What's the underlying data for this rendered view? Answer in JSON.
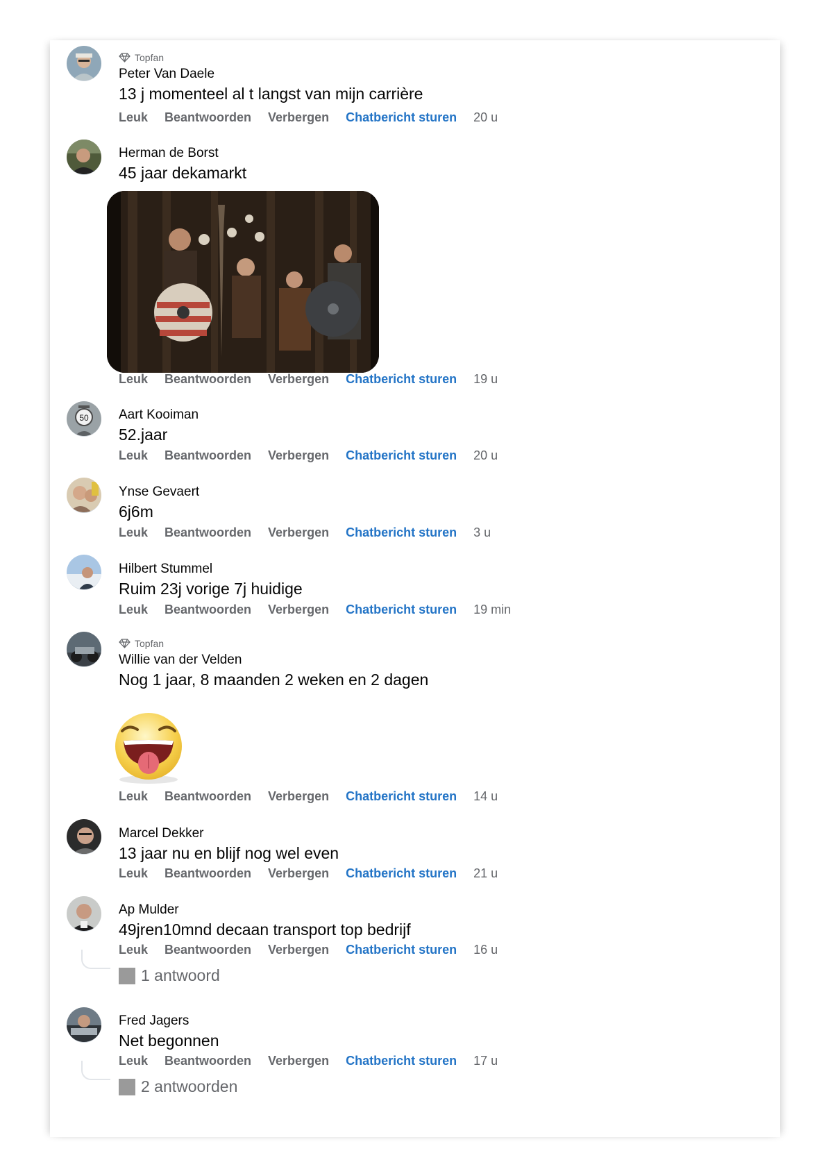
{
  "actions": {
    "like": "Leuk",
    "reply": "Beantwoorden",
    "hide": "Verbergen",
    "chat": "Chatbericht sturen"
  },
  "badge": {
    "topfan": "Topfan"
  },
  "comments": [
    {
      "author": "Peter Van Daele",
      "text": "13 j momenteel al t langst van mijn carrière",
      "time": "20 u",
      "topfan": true
    },
    {
      "author": "Herman de Borst",
      "text": "45 jaar dekamarkt",
      "time": "19 u",
      "media": "photo"
    },
    {
      "author": "Aart Kooiman",
      "text": "52.jaar",
      "time": "20 u"
    },
    {
      "author": "Ynse Gevaert",
      "text": "6j6m",
      "time": "3 u"
    },
    {
      "author": "Hilbert Stummel",
      "text": "Ruim 23j vorige 7j huidige",
      "time": "19 min"
    },
    {
      "author": "Willie van der Velden",
      "text": "Nog 1 jaar, 8 maanden 2 weken en 2 dagen",
      "time": "14 u",
      "topfan": true,
      "media": "emoji"
    },
    {
      "author": "Marcel Dekker",
      "text": "13 jaar nu en blijf nog wel even",
      "time": "21 u"
    },
    {
      "author": "Ap Mulder",
      "text": "49jren10mnd decaan transport top bedrijf",
      "time": "16 u",
      "replies": "1 antwoord"
    },
    {
      "author": "Fred Jagers",
      "text": "Net begonnen",
      "time": "17 u",
      "replies": "2 antwoorden"
    }
  ],
  "colors": {
    "link": "#2374c6",
    "muted": "#65676b",
    "text": "#050505"
  }
}
